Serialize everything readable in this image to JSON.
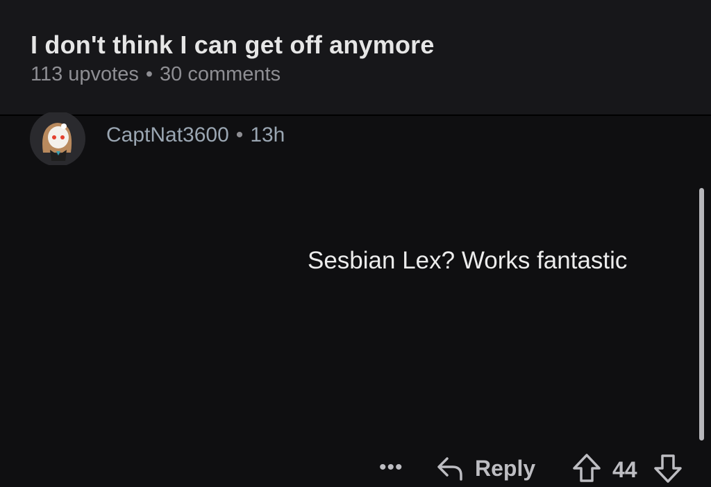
{
  "post": {
    "title": "I don't think I can get off anymore",
    "upvotes": "113 upvotes",
    "separator": "•",
    "comments": "30 comments"
  },
  "comment": {
    "author": "CaptNat3600",
    "separator": "•",
    "time": "13h",
    "body": "Sesbian Lex? Works fantastic",
    "vote_count": "44"
  },
  "actions": {
    "more_label": "•••",
    "reply_label": "Reply"
  },
  "icons": {
    "avatar": "avatar-icon",
    "reply": "reply-arrow-icon",
    "upvote": "upvote-arrow-icon",
    "downvote": "downvote-arrow-icon",
    "more": "more-dots-icon"
  },
  "colors": {
    "background": "#0f0f11",
    "header_background": "#17171a",
    "title": "#e6e6e6",
    "meta": "#8e8e93",
    "author": "#9aa6b2",
    "body_text": "#ececec"
  }
}
